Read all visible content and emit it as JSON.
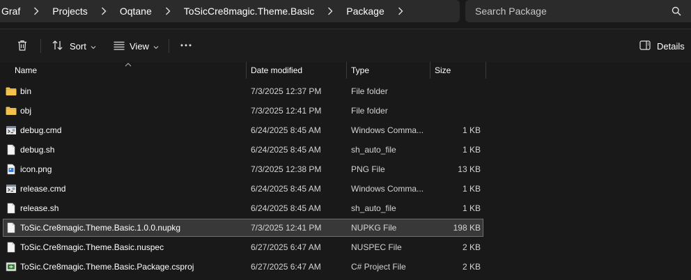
{
  "address": {
    "crumbs": [
      "Graf",
      "Projects",
      "Oqtane",
      "ToSicCre8magic.Theme.Basic",
      "Package"
    ]
  },
  "search": {
    "placeholder": "Search Package"
  },
  "toolbar": {
    "sort_label": "Sort",
    "view_label": "View",
    "more_label": "...",
    "details_label": "Details"
  },
  "columns": {
    "name": "Name",
    "date": "Date modified",
    "type": "Type",
    "size": "Size"
  },
  "files": [
    {
      "name": "bin",
      "date": "7/3/2025 12:37 PM",
      "type": "File folder",
      "size": "",
      "icon": "folder-icon"
    },
    {
      "name": "obj",
      "date": "7/3/2025 12:41 PM",
      "type": "File folder",
      "size": "",
      "icon": "folder-icon"
    },
    {
      "name": "debug.cmd",
      "date": "6/24/2025 8:45 AM",
      "type": "Windows Comma...",
      "size": "1 KB",
      "icon": "cmd-file-icon"
    },
    {
      "name": "debug.sh",
      "date": "6/24/2025 8:45 AM",
      "type": "sh_auto_file",
      "size": "1 KB",
      "icon": "file-icon"
    },
    {
      "name": "icon.png",
      "date": "7/3/2025 12:38 PM",
      "type": "PNG File",
      "size": "13 KB",
      "icon": "image-file-icon"
    },
    {
      "name": "release.cmd",
      "date": "6/24/2025 8:45 AM",
      "type": "Windows Comma...",
      "size": "1 KB",
      "icon": "cmd-file-icon"
    },
    {
      "name": "release.sh",
      "date": "6/24/2025 8:45 AM",
      "type": "sh_auto_file",
      "size": "1 KB",
      "icon": "file-icon"
    },
    {
      "name": "ToSic.Cre8magic.Theme.Basic.1.0.0.nupkg",
      "date": "7/3/2025 12:41 PM",
      "type": "NUPKG File",
      "size": "198 KB",
      "icon": "file-icon",
      "selected": true
    },
    {
      "name": "ToSic.Cre8magic.Theme.Basic.nuspec",
      "date": "6/27/2025 6:47 AM",
      "type": "NUSPEC File",
      "size": "2 KB",
      "icon": "file-icon"
    },
    {
      "name": "ToSic.Cre8magic.Theme.Basic.Package.csproj",
      "date": "6/27/2025 6:47 AM",
      "type": "C# Project File",
      "size": "2 KB",
      "icon": "csproj-file-icon"
    }
  ],
  "colors": {
    "folder": "#f2c14e",
    "background": "#191919",
    "selection": "#383838"
  }
}
